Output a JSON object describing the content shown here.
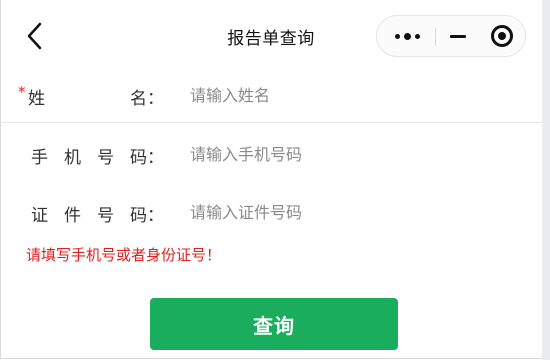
{
  "header": {
    "title": "报告单查询",
    "back_icon": "chevron-left-icon",
    "capsule": {
      "more_icon": "more-dots-icon",
      "minimize_icon": "minimize-icon",
      "close_icon": "target-close-icon"
    }
  },
  "form": {
    "name": {
      "required_mark": "*",
      "label_chars": [
        "姓",
        "名："
      ],
      "placeholder": "请输入姓名",
      "value": ""
    },
    "phone": {
      "label_chars": [
        "手",
        "机",
        "号",
        "码："
      ],
      "placeholder": "请输入手机号码",
      "value": ""
    },
    "id_card": {
      "label_chars": [
        "证",
        "件",
        "号",
        "码："
      ],
      "placeholder": "请输入证件号码",
      "value": ""
    },
    "error_message": "请填写手机号或者身份证号！",
    "submit_label": "查询"
  },
  "colors": {
    "primary_button": "#1aad5e",
    "error_text": "#e02020",
    "placeholder_text": "#8a8a8a"
  }
}
